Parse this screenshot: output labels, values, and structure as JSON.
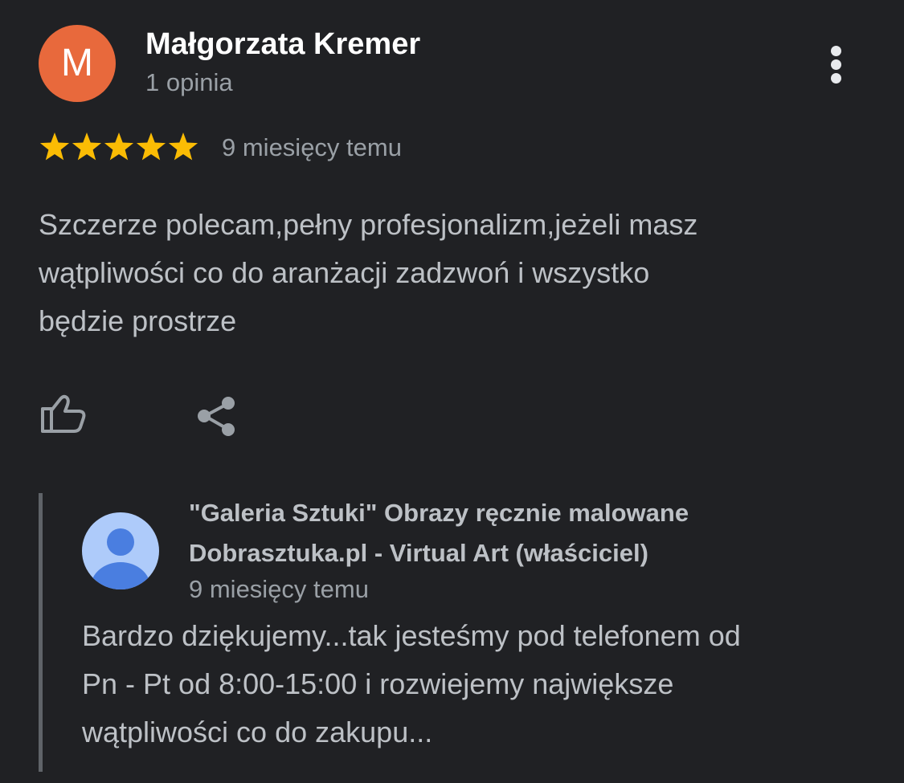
{
  "review": {
    "avatar_letter": "M",
    "avatar_color": "#e8693c",
    "reviewer_name": "Małgorzata Kremer",
    "reviewer_meta": "1 opinia",
    "rating": 5,
    "rating_max": 5,
    "star_color": "#fbbc04",
    "time": "9 miesięcy temu",
    "text_lines": [
      "Szczerze polecam,pełny profesjonalizm,jeżeli masz",
      "wątpliwości co do aranżacji zadzwoń i wszystko",
      "będzie prostrze"
    ],
    "icons": {
      "more": "more-vertical-icon",
      "like": "thumbs-up-icon",
      "share": "share-icon"
    }
  },
  "reply": {
    "owner_name_lines": [
      "\"Galeria Sztuki\" Obrazy ręcznie malowane",
      "Dobrasztuka.pl - Virtual Art (właściciel)"
    ],
    "time": "9 miesięcy temu",
    "text_lines": [
      "Bardzo dziękujemy...tak jesteśmy pod telefonem od",
      "Pn - Pt od 8:00-15:00 i rozwiejemy największe",
      "wątpliwości co do zakupu..."
    ],
    "avatar_icon": "default-profile-avatar-icon",
    "avatar_colors": {
      "background": "#aecbfa",
      "figure": "#4a7ee0"
    }
  },
  "theme": {
    "background": "#202124",
    "primary_text": "#ffffff",
    "body_text": "#bdc1c6",
    "secondary_text": "#9aa0a6",
    "divider": "#5f6368"
  }
}
